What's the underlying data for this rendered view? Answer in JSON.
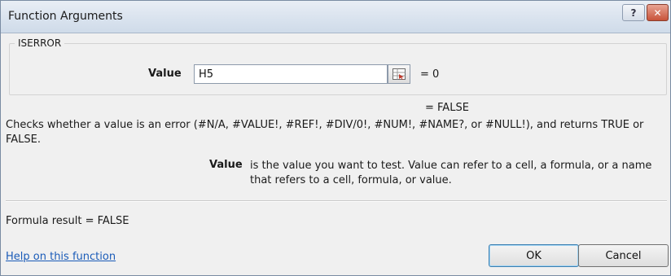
{
  "window": {
    "title": "Function Arguments",
    "help_glyph": "?",
    "close_glyph": "✕"
  },
  "function_group": {
    "name": "ISERROR",
    "argument_label": "Value",
    "argument_value": "H5",
    "argument_result": "=  0",
    "function_result": "=  FALSE"
  },
  "description": {
    "text": "Checks whether a value is an error (#N/A, #VALUE!, #REF!, #DIV/0!, #NUM!, #NAME?, or #NULL!), and returns TRUE or FALSE.",
    "argument_name": "Value",
    "argument_text": "is the value you want to test. Value can refer to a cell, a formula, or a name that refers to a cell, formula, or value."
  },
  "footer": {
    "formula_result": "Formula result =  FALSE",
    "help_link": "Help on this function",
    "ok_label": "OK",
    "cancel_label": "Cancel"
  },
  "colors": {
    "link": "#1a5bb8",
    "close_button": "#c8533a",
    "dialog_background": "#f0f0f0"
  }
}
